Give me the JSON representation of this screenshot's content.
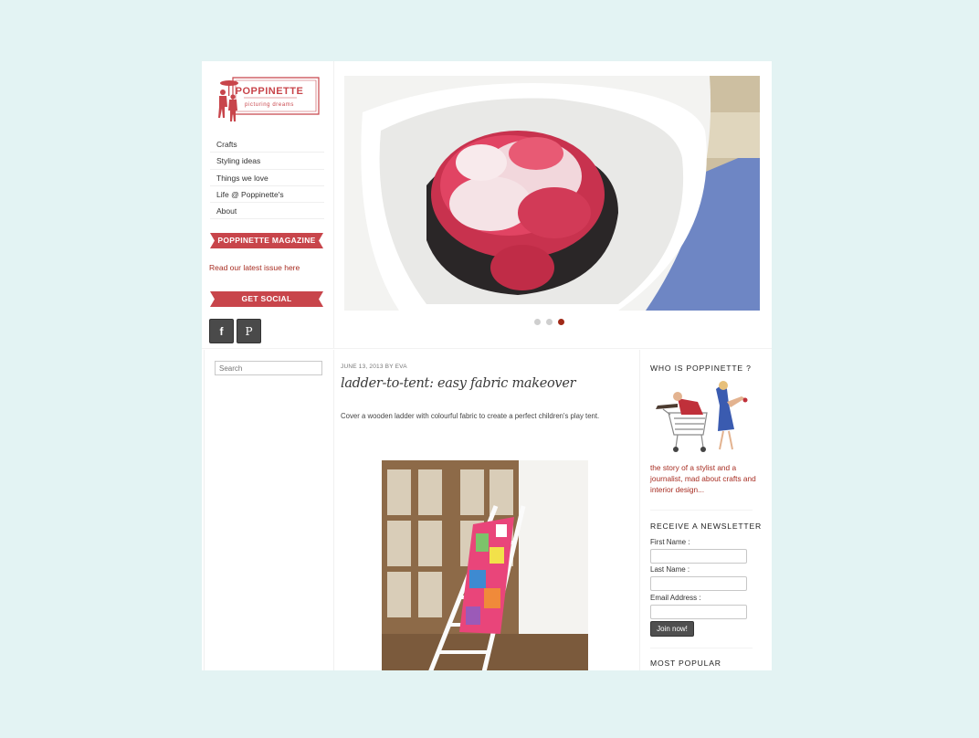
{
  "logo": {
    "name": "POPPINETTE",
    "tagline": "picturing dreams"
  },
  "nav": [
    "Crafts",
    "Styling ideas",
    "Things we love",
    "Life @ Poppinette's",
    "About"
  ],
  "sidebar": {
    "magazine_heading": "POPPINETTE MAGAZINE",
    "magazine_link": "Read our latest issue here",
    "social_heading": "GET SOCIAL",
    "facebook_glyph": "f",
    "pinterest_glyph": "P"
  },
  "slider": {
    "slide_count": 3,
    "active_slide": 3
  },
  "search": {
    "placeholder": "Search"
  },
  "post": {
    "meta": "JUNE 13, 2013 BY EVA",
    "title": "ladder-to-tent: easy fabric makeover",
    "excerpt": "Cover a wooden ladder with colourful fabric to create a perfect children's play tent."
  },
  "right": {
    "who_heading": "WHO IS POPPINETTE ?",
    "who_text": "the story of a stylist and a journalist, mad about crafts and interior design...",
    "newsletter_heading": "RECEIVE A NEWSLETTER",
    "first_name_label": "First Name :",
    "last_name_label": "Last Name :",
    "email_label": "Email Address :",
    "join_label": "Join now!",
    "popular_heading": "MOST POPULAR"
  },
  "colors": {
    "page_bg": "#e3f3f3",
    "accent_red": "#c8454b",
    "link_red": "#a72d22",
    "button_dark": "#4f4f4f"
  }
}
